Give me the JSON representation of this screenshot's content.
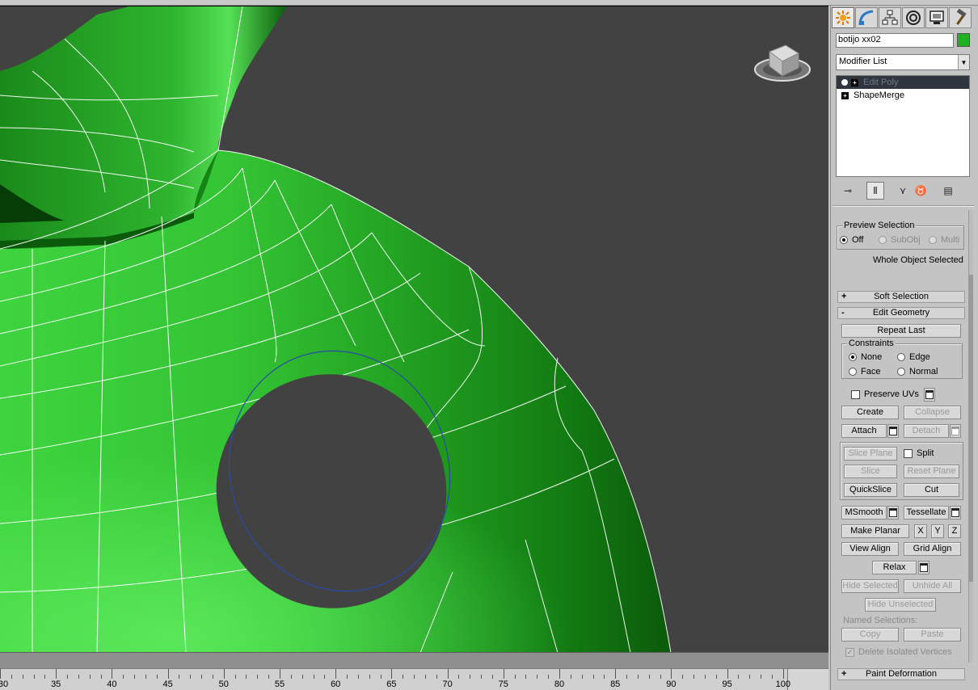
{
  "viewport": {
    "background": "#424242",
    "mesh_color": "#2eb02e",
    "wire_color": "#ffffff",
    "hole_outline_color": "#2a4aa8"
  },
  "timeline": {
    "ticks": [
      "30",
      "35",
      "40",
      "45",
      "50",
      "55",
      "60",
      "65",
      "70",
      "75",
      "80",
      "85",
      "90",
      "95",
      "100"
    ]
  },
  "panel": {
    "tabs": [
      "create-tab",
      "modify-tab",
      "hierarchy-tab",
      "motion-tab",
      "display-tab",
      "utilities-tab"
    ],
    "object_name": "botijo xx02",
    "object_color": "#22b022",
    "modifier_list": "Modifier List",
    "stack": [
      {
        "label": "Edit Poly",
        "selected": true
      },
      {
        "label": "ShapeMerge",
        "selected": false
      }
    ],
    "preview_selection": {
      "title": "Preview Selection",
      "options": [
        "Off",
        "SubObj",
        "Multi"
      ],
      "status": "Whole Object Selected"
    },
    "soft_selection": {
      "sign": "+",
      "label": "Soft Selection"
    },
    "edit_geometry": {
      "sign": "-",
      "label": "Edit Geometry",
      "repeat_last": "Repeat Last",
      "constraints_title": "Constraints",
      "constraints": [
        "None",
        "Edge",
        "Face",
        "Normal"
      ],
      "preserve_uvs": "Preserve UVs",
      "create": "Create",
      "collapse": "Collapse",
      "attach": "Attach",
      "detach": "Detach",
      "slice_plane": "Slice Plane",
      "split": "Split",
      "slice": "Slice",
      "reset_plane": "Reset Plane",
      "quickslice": "QuickSlice",
      "cut": "Cut",
      "msmooth": "MSmooth",
      "tessellate": "Tessellate",
      "make_planar": "Make Planar",
      "x": "X",
      "y": "Y",
      "z": "Z",
      "view_align": "View Align",
      "grid_align": "Grid Align",
      "relax": "Relax",
      "hide_selected": "Hide Selected",
      "unhide_all": "Unhide All",
      "hide_unselected": "Hide Unselected",
      "named_selections": "Named Selections:",
      "copy": "Copy",
      "paste": "Paste",
      "delete_isolated": "Delete Isolated Vertices"
    },
    "paint_deformation": {
      "sign": "+",
      "label": "Paint Deformation"
    }
  }
}
